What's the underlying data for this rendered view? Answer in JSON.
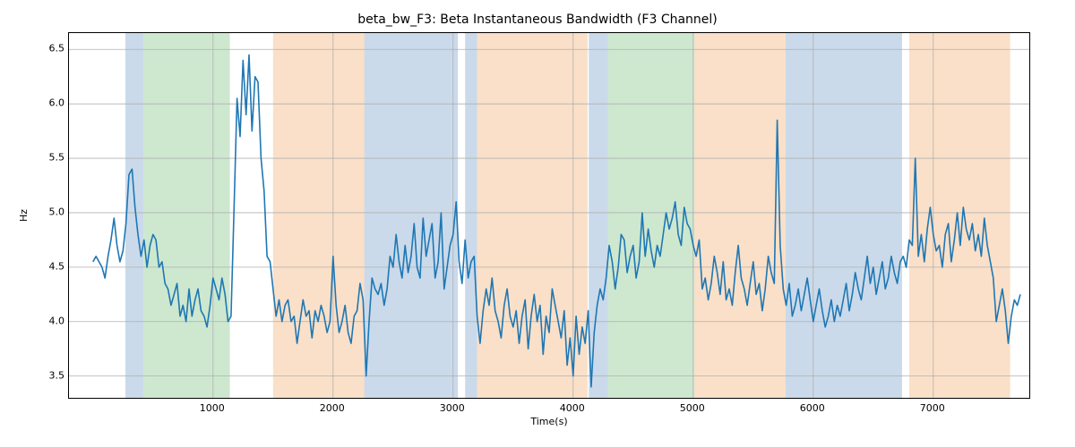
{
  "chart_data": {
    "type": "line",
    "title": "beta_bw_F3: Beta Instantaneous Bandwidth (F3 Channel)",
    "xlabel": "Time(s)",
    "ylabel": "Hz",
    "xlim": [
      -200,
      7800
    ],
    "ylim": [
      3.3,
      6.65
    ],
    "xticks": [
      1000,
      2000,
      3000,
      4000,
      5000,
      6000,
      7000
    ],
    "yticks": [
      3.5,
      4.0,
      4.5,
      5.0,
      5.5,
      6.0,
      6.5
    ],
    "grid": true,
    "bands": [
      {
        "start": 270,
        "end": 420,
        "class": "blue"
      },
      {
        "start": 420,
        "end": 1140,
        "class": "green"
      },
      {
        "start": 1500,
        "end": 2260,
        "class": "orange"
      },
      {
        "start": 2260,
        "end": 3040,
        "class": "blue"
      },
      {
        "start": 3100,
        "end": 3200,
        "class": "blue"
      },
      {
        "start": 3200,
        "end": 4120,
        "class": "orange"
      },
      {
        "start": 4130,
        "end": 4290,
        "class": "blue"
      },
      {
        "start": 4290,
        "end": 5010,
        "class": "green"
      },
      {
        "start": 5010,
        "end": 5770,
        "class": "orange"
      },
      {
        "start": 5770,
        "end": 5870,
        "class": "blue"
      },
      {
        "start": 5870,
        "end": 6740,
        "class": "blue"
      },
      {
        "start": 6800,
        "end": 6900,
        "class": "orange"
      },
      {
        "start": 6900,
        "end": 7640,
        "class": "orange"
      }
    ],
    "series": [
      {
        "name": "beta_bw_F3",
        "x_start": 0,
        "x_step": 25,
        "values": [
          4.55,
          4.6,
          4.55,
          4.5,
          4.4,
          4.6,
          4.75,
          4.95,
          4.7,
          4.55,
          4.65,
          4.9,
          5.35,
          5.4,
          5.05,
          4.8,
          4.6,
          4.75,
          4.5,
          4.7,
          4.8,
          4.75,
          4.5,
          4.55,
          4.35,
          4.3,
          4.15,
          4.25,
          4.35,
          4.05,
          4.15,
          4.0,
          4.3,
          4.05,
          4.2,
          4.3,
          4.1,
          4.05,
          3.95,
          4.15,
          4.4,
          4.3,
          4.2,
          4.4,
          4.25,
          4.0,
          4.05,
          5.05,
          6.05,
          5.7,
          6.4,
          5.9,
          6.45,
          5.75,
          6.25,
          6.2,
          5.5,
          5.2,
          4.6,
          4.55,
          4.3,
          4.05,
          4.2,
          4.0,
          4.15,
          4.2,
          4.0,
          4.05,
          3.8,
          4.0,
          4.2,
          4.05,
          4.1,
          3.85,
          4.1,
          4.0,
          4.15,
          4.05,
          3.9,
          4.0,
          4.6,
          4.15,
          3.9,
          4.0,
          4.15,
          3.9,
          3.8,
          4.05,
          4.1,
          4.35,
          4.2,
          3.5,
          4.0,
          4.4,
          4.3,
          4.25,
          4.35,
          4.15,
          4.3,
          4.6,
          4.5,
          4.8,
          4.55,
          4.4,
          4.7,
          4.45,
          4.6,
          4.9,
          4.5,
          4.4,
          4.95,
          4.6,
          4.75,
          4.9,
          4.4,
          4.55,
          5.0,
          4.3,
          4.5,
          4.7,
          4.8,
          5.1,
          4.55,
          4.35,
          4.75,
          4.4,
          4.55,
          4.6,
          4.05,
          3.8,
          4.1,
          4.3,
          4.15,
          4.4,
          4.1,
          4.0,
          3.85,
          4.15,
          4.3,
          4.05,
          3.95,
          4.1,
          3.8,
          4.05,
          4.2,
          3.75,
          4.05,
          4.25,
          4.0,
          4.15,
          3.7,
          4.05,
          3.9,
          4.3,
          4.15,
          4.0,
          3.85,
          4.1,
          3.6,
          3.85,
          3.5,
          4.05,
          3.7,
          3.95,
          3.8,
          4.1,
          3.4,
          3.9,
          4.15,
          4.3,
          4.2,
          4.4,
          4.7,
          4.55,
          4.3,
          4.5,
          4.8,
          4.75,
          4.45,
          4.6,
          4.7,
          4.4,
          4.55,
          5.0,
          4.6,
          4.85,
          4.65,
          4.5,
          4.7,
          4.6,
          4.8,
          5.0,
          4.85,
          4.95,
          5.1,
          4.8,
          4.7,
          5.05,
          4.9,
          4.85,
          4.7,
          4.6,
          4.75,
          4.3,
          4.4,
          4.2,
          4.35,
          4.6,
          4.45,
          4.25,
          4.55,
          4.2,
          4.3,
          4.15,
          4.45,
          4.7,
          4.4,
          4.3,
          4.15,
          4.35,
          4.55,
          4.25,
          4.35,
          4.1,
          4.3,
          4.6,
          4.45,
          4.35,
          5.85,
          4.7,
          4.3,
          4.15,
          4.35,
          4.05,
          4.15,
          4.3,
          4.1,
          4.25,
          4.4,
          4.2,
          4.0,
          4.15,
          4.3,
          4.1,
          3.95,
          4.05,
          4.2,
          4.0,
          4.15,
          4.05,
          4.2,
          4.35,
          4.1,
          4.25,
          4.45,
          4.3,
          4.2,
          4.4,
          4.6,
          4.35,
          4.5,
          4.25,
          4.4,
          4.55,
          4.3,
          4.4,
          4.6,
          4.45,
          4.35,
          4.55,
          4.6,
          4.5,
          4.75,
          4.7,
          5.5,
          4.6,
          4.8,
          4.55,
          4.85,
          5.05,
          4.8,
          4.65,
          4.7,
          4.5,
          4.8,
          4.9,
          4.55,
          4.75,
          5.0,
          4.7,
          5.05,
          4.85,
          4.75,
          4.9,
          4.65,
          4.8,
          4.6,
          4.95,
          4.7,
          4.55,
          4.4,
          4.0,
          4.15,
          4.3,
          4.1,
          3.8,
          4.05,
          4.2,
          4.15,
          4.25
        ]
      }
    ]
  },
  "colors": {
    "line": "#1f77b4",
    "band_blue": "#3f7ab3",
    "band_green": "#4bab54",
    "band_orange": "#ed903b"
  }
}
